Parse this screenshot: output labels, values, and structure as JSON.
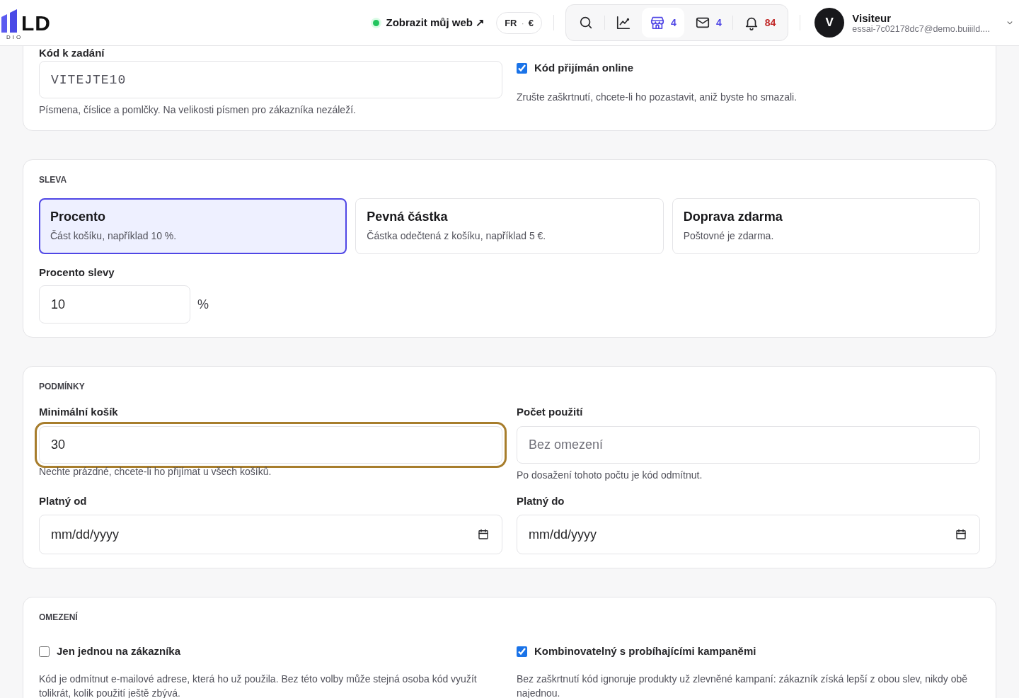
{
  "header": {
    "logo": {
      "mark": "LD",
      "sub": "DIO"
    },
    "site_link": {
      "label": "Zobrazit můj web ↗",
      "online": true
    },
    "locale": {
      "language": "FR",
      "separator": "·",
      "currency": "€"
    },
    "toolbar": [
      {
        "kind": "search",
        "selected": false
      },
      {
        "kind": "chart",
        "selected": false
      },
      {
        "kind": "store",
        "count": "4",
        "selected": true
      },
      {
        "kind": "mail",
        "count": "4",
        "selected": false
      },
      {
        "kind": "bell",
        "count": "84",
        "selected": false
      }
    ],
    "user": {
      "initial": "V",
      "name": "Visiteur",
      "email": "essai-7c02178dc7@demo.buiiild...."
    }
  },
  "code_section": {
    "label": "Kód k zadání",
    "value": "VITEJTE10",
    "hint": "Písmena, číslice a pomlčky. Na velikosti písmen pro zákazníka nezáleží.",
    "online": {
      "label": "Kód přijímán online",
      "checked": true,
      "hint": "Zrušte zaškrtnutí, chcete-li ho pozastavit, aniž byste ho smazali."
    }
  },
  "discount": {
    "title": "SLEVA",
    "options": [
      {
        "title": "Procento",
        "description": "Část košíku, například 10 %.",
        "selected": true
      },
      {
        "title": "Pevná částka",
        "description": "Částka odečtená z košíku, například 5 €.",
        "selected": false
      },
      {
        "title": "Doprava zdarma",
        "description": "Poštovné je zdarma.",
        "selected": false
      }
    ],
    "percent": {
      "label": "Procento slevy",
      "value": "10",
      "unit": "%"
    }
  },
  "conditions": {
    "title": "PODMÍNKY",
    "fields": [
      {
        "kind": "text",
        "label": "Minimální košík",
        "value": "30",
        "hint": "Nechte prázdné, chcete-li ho přijímat u všech košíků.",
        "focused": true
      },
      {
        "kind": "text",
        "label": "Počet použití",
        "placeholder": "Bez omezení",
        "hint": "Po dosažení tohoto počtu je kód odmítnut.",
        "focused": false
      },
      {
        "kind": "date",
        "label": "Platný od",
        "value": "mm/dd/yyyy",
        "focused": false
      },
      {
        "kind": "date",
        "label": "Platný do",
        "value": "mm/dd/yyyy",
        "focused": false
      }
    ]
  },
  "limits": {
    "title": "OMEZENÍ",
    "options": [
      {
        "label": "Jen jednou na zákazníka",
        "checked": false,
        "hint": "Kód je odmítnut e-mailové adrese, která ho už použila. Bez této volby může stejná osoba kód využít tolikrát, kolik použití ještě zbývá."
      },
      {
        "label": "Kombinovatelný s probíhajícími kampaněmi",
        "checked": true,
        "hint": "Bez zaškrtnutí kód ignoruje produkty už zlevněné kampaní: zákazník získá lepší z obou slev, nikdy obě najednou."
      }
    ]
  }
}
